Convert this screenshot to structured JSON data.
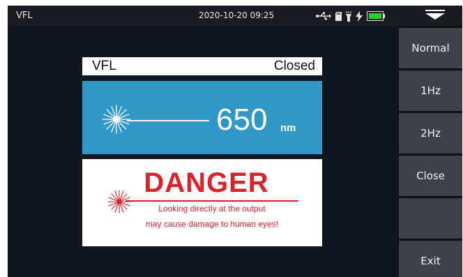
{
  "statusbar": {
    "title": "VFL",
    "datetime": "2020-10-20 09:25",
    "icons": [
      "usb-icon",
      "sd-card-icon",
      "flashlight-icon",
      "charging-bolt-icon",
      "battery-icon",
      "menu-dropdown-icon"
    ],
    "battery_color": "#2bd12b"
  },
  "panel": {
    "label": "VFL",
    "status": "Closed"
  },
  "wavelength": {
    "value": "650",
    "unit": "nm",
    "bg_color": "#3197c8"
  },
  "warning": {
    "title": "DANGER",
    "line1": "Looking directly at the output",
    "line2": "may cause damage to human eyes!",
    "color": "#d7232a"
  },
  "sidebar": {
    "buttons": [
      {
        "label": "Normal"
      },
      {
        "label": "1Hz"
      },
      {
        "label": "2Hz"
      },
      {
        "label": "Close"
      },
      {
        "label": ""
      },
      {
        "label": "Exit"
      }
    ]
  }
}
